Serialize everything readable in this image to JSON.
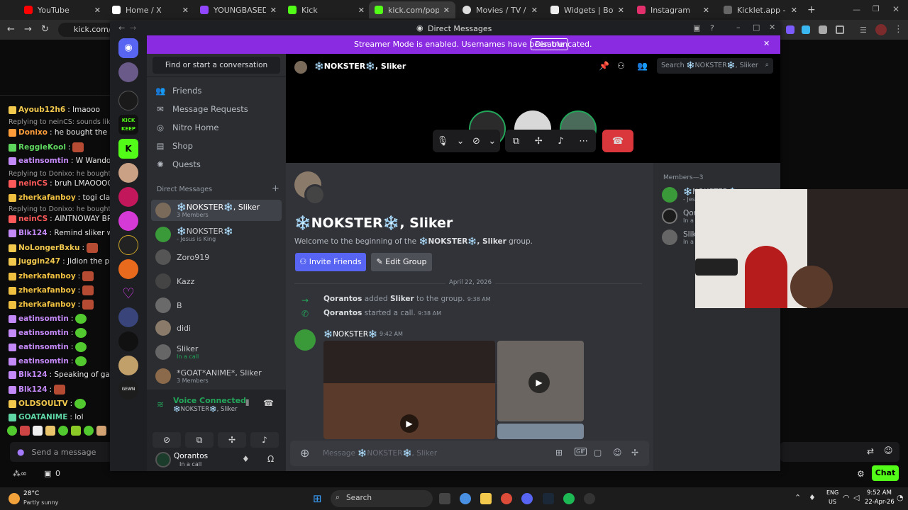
{
  "browser": {
    "tabs": [
      {
        "label": "YouTube",
        "color": "#ff0000"
      },
      {
        "label": "Home / X",
        "color": "#ffffff"
      },
      {
        "label": "YOUNGBASEDGO - T",
        "color": "#9146ff"
      },
      {
        "label": "Kick",
        "color": "#53fc18"
      },
      {
        "label": "kick.com/popout/q",
        "color": "#53fc18"
      },
      {
        "label": "Movies / TV / Anime",
        "color": "#dddddd"
      },
      {
        "label": "Widgets | BotRix —",
        "color": "#eeeeee"
      },
      {
        "label": "Instagram",
        "color": "#e1306c"
      },
      {
        "label": "Kicklet.app - Kick Cha",
        "color": "#666666"
      }
    ],
    "address": "kick.com/po"
  },
  "kick_chat": {
    "lines": [
      {
        "reply": "",
        "user": "Ayoub12h6",
        "user_color": "#f2c94c",
        "text": ": lmaooo"
      },
      {
        "reply": "Replying to neinCS: sounds like it l",
        "user": "",
        "user_color": "",
        "text": ""
      },
      {
        "reply": "",
        "user": "Donixo",
        "user_color": "#ff9d3a",
        "text": ": he bought the same"
      },
      {
        "reply": "",
        "user": "ReggieKool",
        "user_color": "#5ed65e",
        "text": ":"
      },
      {
        "reply": "",
        "user": "eatinsomtin",
        "user_color": "#c58af9",
        "text": ": W Wando"
      },
      {
        "reply": "Replying to Donixo: he bought the",
        "user": "",
        "user_color": "",
        "text": ""
      },
      {
        "reply": "",
        "user": "neinCS",
        "user_color": "#ff5959",
        "text": ": bruh LMAOOOOOOOO"
      },
      {
        "reply": "",
        "user": "zherkafanboy",
        "user_color": "#f0c040",
        "text": ": togi clav edmat"
      },
      {
        "reply": "Replying to Donixo: he bought the",
        "user": "",
        "user_color": "",
        "text": ""
      },
      {
        "reply": "",
        "user": "neinCS",
        "user_color": "#ff5959",
        "text": ": AINTNOWAY BRUH"
      },
      {
        "reply": "",
        "user": "Blk124",
        "user_color": "#c58af9",
        "text": ": Remind sliker w"
      },
      {
        "reply": "",
        "user": "NoLongerBxku",
        "user_color": "#f2c94c",
        "text": ":"
      },
      {
        "reply": "",
        "user": "juggin247",
        "user_color": "#f2c94c",
        "text": ": Jidion the prank YouTu"
      },
      {
        "reply": "",
        "user": "zherkafanboy",
        "user_color": "#f0c040",
        "text": ":"
      },
      {
        "reply": "",
        "user": "zherkafanboy",
        "user_color": "#f0c040",
        "text": ":"
      },
      {
        "reply": "",
        "user": "zherkafanboy",
        "user_color": "#f0c040",
        "text": ":"
      },
      {
        "reply": "",
        "user": "eatinsomtin",
        "user_color": "#c58af9",
        "text": ":"
      },
      {
        "reply": "",
        "user": "eatinsomtin",
        "user_color": "#c58af9",
        "text": ":"
      },
      {
        "reply": "",
        "user": "eatinsomtin",
        "user_color": "#c58af9",
        "text": ":"
      },
      {
        "reply": "",
        "user": "eatinsomtin",
        "user_color": "#c58af9",
        "text": ":"
      },
      {
        "reply": "",
        "user": "Blk124",
        "user_color": "#c58af9",
        "text": ": Speaking of gat"
      },
      {
        "reply": "",
        "user": "Blk124",
        "user_color": "#c58af9",
        "text": ":"
      },
      {
        "reply": "",
        "user": "OLDSOULTV",
        "user_color": "#f2c94c",
        "text": ":"
      },
      {
        "reply": "",
        "user": "GOATANIME",
        "user_color": "#5ed6a5",
        "text": ": lol"
      }
    ],
    "send_placeholder": "Send a message",
    "count": "0",
    "chat_button": "Chat"
  },
  "discord": {
    "window_title": "Direct Messages",
    "banner_text": "Streamer Mode is enabled. Usernames have been truncated.",
    "banner_button": "Disable",
    "find_placeholder": "Find or start a conversation",
    "nav": [
      "Friends",
      "Message Requests",
      "Nitro Home",
      "Shop",
      "Quests"
    ],
    "dm_header": "Direct Messages",
    "dms": [
      {
        "name": "❄️NOKSTER❄️, Sliker",
        "sub": "3 Members",
        "color": "#7a6a5a"
      },
      {
        "name": "❄️NOKSTER❄️",
        "sub": "- Jesus is King",
        "color": "#3a9a3a"
      },
      {
        "name": "Zoro919",
        "sub": "",
        "color": "#555"
      },
      {
        "name": "Kazz",
        "sub": "",
        "color": "#444"
      },
      {
        "name": "B",
        "sub": "",
        "color": "#6a6a6a"
      },
      {
        "name": "didi",
        "sub": "",
        "color": "#8a7a6a"
      },
      {
        "name": "Sliker",
        "sub": "In a call",
        "color": "#666"
      },
      {
        "name": "*GOAT*ANIME*, Sliker",
        "sub": "3 Members",
        "color": "#8a6a4a"
      }
    ],
    "voice_status": "Voice Connected",
    "voice_channel": "❄️NOKSTER❄️, Sliker",
    "user_name": "Qorantos",
    "user_status": "In a call",
    "channel_title": "❄️NOKSTER❄️, Sliker",
    "search_placeholder": "Search ❄️NOKSTER❄️, Sliker",
    "welcome_title": "❄️NOKSTER❄️, Sliker",
    "welcome_prefix": "Welcome to the beginning of the ",
    "welcome_group": "❄️NOKSTER❄️, Sliker",
    "welcome_suffix": " group.",
    "invite_button": "Invite Friends",
    "edit_button": "Edit Group",
    "date_divider": "April 22, 2026",
    "sys1_actor": "Qorantos",
    "sys1_mid": " added ",
    "sys1_target": "Sliker",
    "sys1_end": " to the group.",
    "sys1_time": "9:38 AM",
    "sys2_actor": "Qorantos",
    "sys2_text": " started a call.",
    "sys2_time": "9:38 AM",
    "msg_author": "❄️NOKSTER❄️",
    "msg_time": "9:42 AM",
    "message_placeholder": "Message ❄️NOKSTER❄️, Sliker",
    "members_header": "Members—3",
    "members": [
      {
        "name": "❄️NOKSTER❄️",
        "sub": "- Jesus is King"
      },
      {
        "name": "Qorantos",
        "sub": "In a call"
      },
      {
        "name": "Sliker",
        "sub": "In a call"
      }
    ]
  },
  "taskbar": {
    "weather_temp": "28°C",
    "weather_desc": "Partly sunny",
    "search_label": "Search",
    "lang1": "ENG",
    "lang2": "US",
    "time": "9:52 AM",
    "date": "22-Apr-26"
  },
  "colors": {
    "discord_blurple": "#5865f2",
    "streamer_purple": "#8a2be2",
    "hangup_red": "#da373c",
    "kick_green": "#53fc18"
  }
}
